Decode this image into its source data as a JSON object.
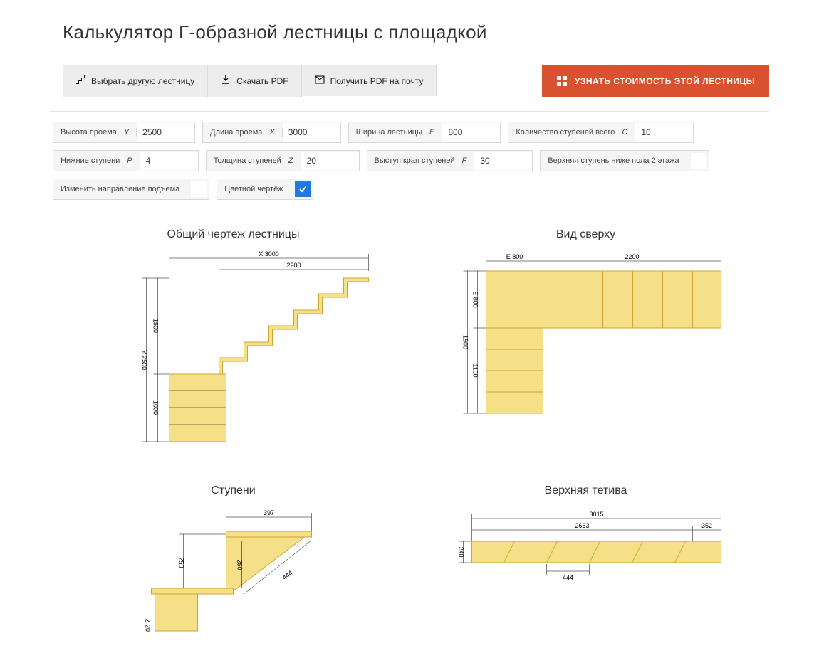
{
  "title": "Калькулятор Г-образной лестницы с площадкой",
  "toolbar": {
    "choose": "Выбрать другую лестницу",
    "download": "Скачать PDF",
    "email": "Получить PDF на почту",
    "cta": "УЗНАТЬ СТОИМОСТЬ ЭТОЙ ЛЕСТНИЦЫ"
  },
  "params": {
    "height": {
      "label": "Высота проема",
      "sym": "Y",
      "value": "2500"
    },
    "length": {
      "label": "Длина проема",
      "sym": "X",
      "value": "3000"
    },
    "width": {
      "label": "Ширина лестницы",
      "sym": "E",
      "value": "800"
    },
    "steps": {
      "label": "Количество ступеней всего",
      "sym": "C",
      "value": "10"
    },
    "lower": {
      "label": "Нижние ступени",
      "sym": "P",
      "value": "4"
    },
    "thick": {
      "label": "Толщина ступеней",
      "sym": "Z",
      "value": "20"
    },
    "overhang": {
      "label": "Выступ края ступеней",
      "sym": "F",
      "value": "30"
    },
    "topBelow": {
      "label": "Верхняя ступень ниже пола 2 этажа",
      "checked": false
    },
    "flip": {
      "label": "Изменить направление подъема",
      "checked": false
    },
    "color": {
      "label": "Цветной чертёж",
      "checked": true
    }
  },
  "diagrams": {
    "overall": {
      "title": "Общий чертеж лестницы",
      "dims": {
        "X": "X 3000",
        "upper": "2200",
        "Y": "Y 2500",
        "midH": "1500",
        "lowH": "1000"
      }
    },
    "top": {
      "title": "Вид сверху",
      "dims": {
        "E": "E 800",
        "upper": "2200",
        "Eside": "E 800",
        "midV": "1100",
        "totalV": "1900"
      }
    },
    "step": {
      "title": "Ступени",
      "dims": {
        "top": "397",
        "rise": "250",
        "rise2": "250",
        "diag": "444",
        "Z": "Z 20"
      }
    },
    "stringer": {
      "title": "Верхняя тетива",
      "dims": {
        "total": "3015",
        "inner": "2663",
        "right": "352",
        "h": "240",
        "diag": "444"
      }
    }
  }
}
